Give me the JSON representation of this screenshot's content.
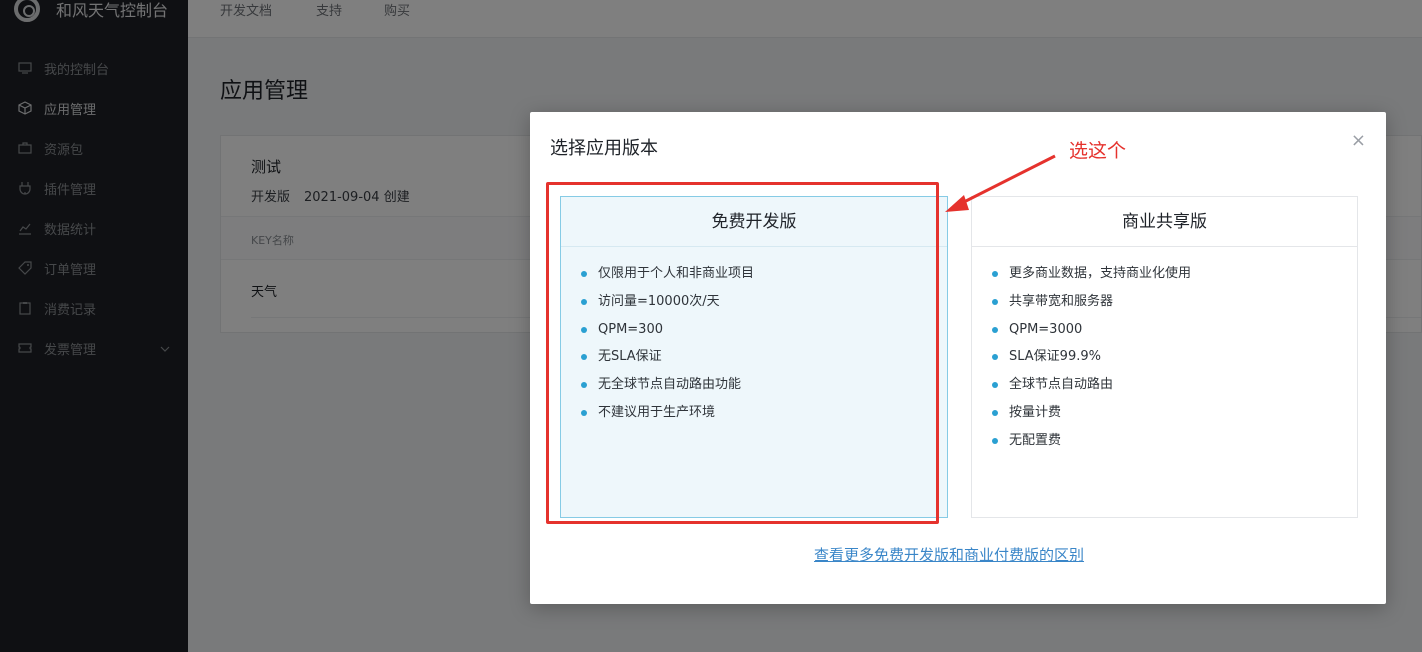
{
  "app": {
    "title": "和风天气控制台"
  },
  "sidebar": {
    "items": [
      {
        "label": "我的控制台",
        "icon": "monitor-icon"
      },
      {
        "label": "应用管理",
        "icon": "cube-icon",
        "active": true
      },
      {
        "label": "资源包",
        "icon": "briefcase-icon"
      },
      {
        "label": "插件管理",
        "icon": "plug-icon"
      },
      {
        "label": "数据统计",
        "icon": "chart-icon"
      },
      {
        "label": "订单管理",
        "icon": "tag-icon"
      },
      {
        "label": "消费记录",
        "icon": "clipboard-icon"
      },
      {
        "label": "发票管理",
        "icon": "ticket-icon",
        "expandable": true
      }
    ]
  },
  "topnav": {
    "links": [
      "开发文档",
      "支持",
      "购买"
    ]
  },
  "main": {
    "page_title": "应用管理",
    "app_card": {
      "name": "测试",
      "edition": "开发版",
      "created": "2021-09-04 创建",
      "key_header": "KEY名称",
      "key_row": "天气"
    }
  },
  "modal": {
    "title": "选择应用版本",
    "close_symbol": "×",
    "plans": [
      {
        "name": "免费开发版",
        "features": [
          "仅限用于个人和非商业项目",
          "访问量=10000次/天",
          "QPM=300",
          "无SLA保证",
          "无全球节点自动路由功能",
          "不建议用于生产环境"
        ]
      },
      {
        "name": "商业共享版",
        "features": [
          "更多商业数据，支持商业化使用",
          "共享带宽和服务器",
          "QPM=3000",
          "SLA保证99.9%",
          "全球节点自动路由",
          "按量计费",
          "无配置费"
        ]
      }
    ],
    "compare_link": "查看更多免费开发版和商业付费版的区别"
  },
  "annotation": {
    "text": "选这个",
    "color": "#e5322d"
  },
  "colors": {
    "accent": "#2aa0d2",
    "link": "#3a86c8",
    "sidebar_bg": "#1e2126"
  }
}
